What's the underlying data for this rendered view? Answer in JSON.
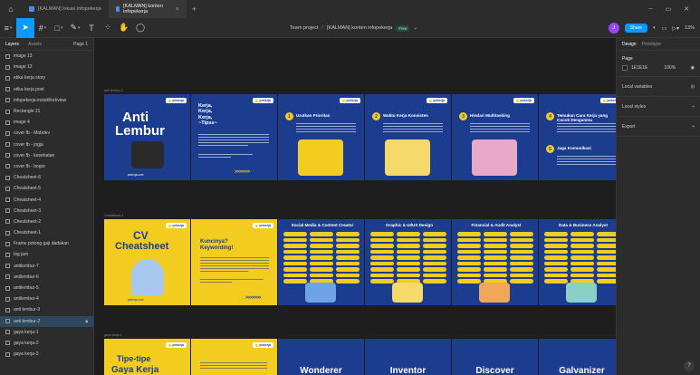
{
  "titlebar": {
    "tabs": [
      {
        "label": "[KALMAN] lokasi infopekerja",
        "active": false
      },
      {
        "label": "[KALMAN] konten infopekerja",
        "active": true
      }
    ],
    "win_controls": [
      "–",
      "▭",
      "✕"
    ]
  },
  "toolbar": {
    "project_prefix": "Team project",
    "project_sep": "/",
    "project_name": "[KALMAN] konten infopekerja",
    "plan_badge": "Free",
    "avatar_initial": "J",
    "share_label": "Share",
    "zoom_label": "13%"
  },
  "left_panel": {
    "tab_layers": "Layers",
    "tab_assets": "Assets",
    "page_label": "Page 1",
    "layers": [
      "image 13",
      "image 12",
      "etika kerja story",
      "etika kerja post",
      "infopekerja-instaWorkview",
      "Rectangle 21",
      "image 4",
      "cover fb - Mobdev",
      "cover fb - jogja",
      "cover fb - kesehatan",
      "cover fb - bogor",
      "Cheatsheet-6",
      "Cheatsheet-5",
      "Cheatsheet-4",
      "Cheatsheet-3",
      "Cheatsheet-2",
      "Cheatsheet-1",
      "Frame potong gaji dadakan",
      "log jam",
      "antilembur-7",
      "antilembur-6",
      "antilembur-5",
      "antilembur-4",
      "anti lembur-3",
      "anti lembur-2",
      "gaya kerja-1",
      "gaya kerja-2",
      "gaya kerja-3"
    ],
    "selected_index": 24
  },
  "right_panel": {
    "tab_design": "Design",
    "tab_prototype": "Prototype",
    "page_title": "Page",
    "page_color": "1E1E1E",
    "page_opacity": "100%",
    "items": [
      {
        "label": "Local variables",
        "action": "⊞"
      },
      {
        "label": "Local styles",
        "action": "+"
      },
      {
        "label": "Export",
        "action": "+"
      }
    ],
    "help": "?"
  },
  "canvas": {
    "logo_text": "pekerja",
    "row1_label": "anti lembur-1",
    "anti_lembur_title": [
      "Anti",
      "Lembur"
    ],
    "kerja_title": [
      "Kerja,",
      "Kerja,",
      "Kerja,",
      "~Tipss~"
    ],
    "tips": [
      {
        "n": "1",
        "title": "Urutkan Prioritas"
      },
      {
        "n": "2",
        "title": "Waktu Kerja Konsisten"
      },
      {
        "n": "3",
        "title": "Hindari Multitasking"
      },
      {
        "n": "4",
        "title": "Temukan Cara Kerja yang Cocok Denganmu"
      },
      {
        "n": "5",
        "title": "Jaga Komunikasi"
      }
    ],
    "row2_label": "Cheatsheet-1",
    "cv_title": [
      "CV",
      "Cheatsheet"
    ],
    "keyword_title": [
      "Kuncinya?",
      "Keywording!"
    ],
    "cheatsheets": [
      "Social Media & Content Creator",
      "Graphic & UI/UX Design",
      "Financial & Audit Analyst",
      "Data & Business Analyst"
    ],
    "arrows": ">>>>>>>",
    "footer": "pekerja.com",
    "row3_label": "gaya kerja-1",
    "gaya_title": [
      "Tipe-tipe",
      "Gaya Kerja"
    ],
    "gaya_types": [
      "Wonderer",
      "Inventor",
      "Discover",
      "Galvanizer"
    ]
  }
}
